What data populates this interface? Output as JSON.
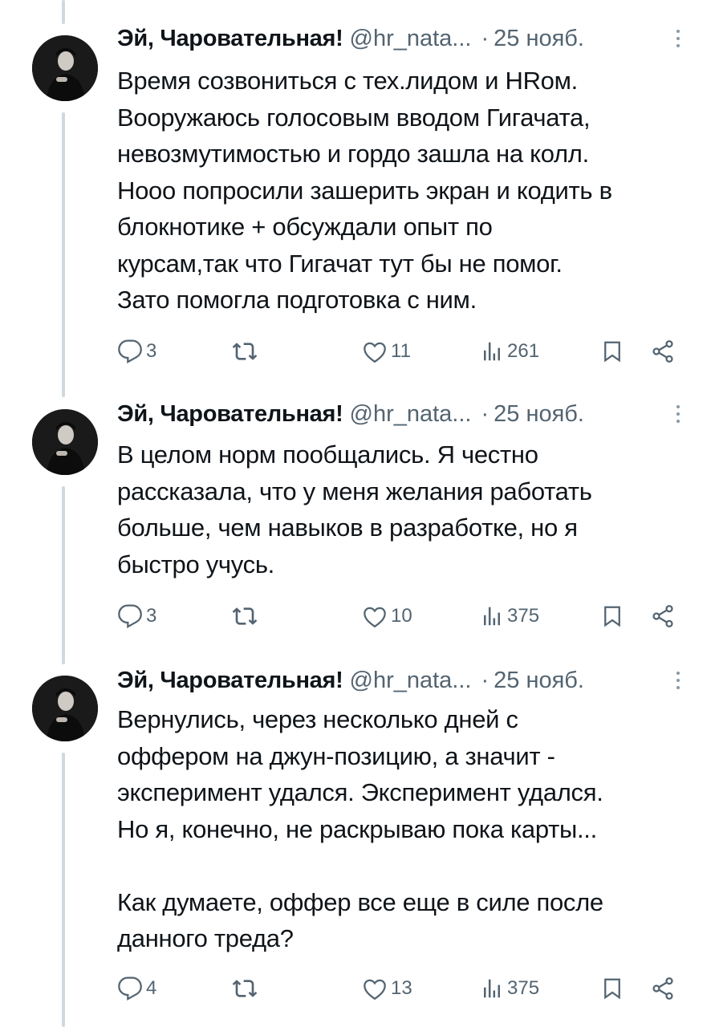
{
  "tweets": [
    {
      "author_name": "Эй, Чаровательная!",
      "handle": "@hr_nata...",
      "separator": "·",
      "date": "25 нояб.",
      "text": "Время созвониться с тех.лидом и HRом.\nВооружаюсь голосовым вводом Гигачата,\nневозмутимостью и гордо зашла на колл.\nНооо попросили зашерить экран и кодить в\nблокнотике + обсуждали опыт по\nкурсам,так что Гигачат тут бы не помог.\nЗато помогла подготовка с ним.",
      "replies": "3",
      "retweets": "",
      "likes": "11",
      "views": "261"
    },
    {
      "author_name": "Эй, Чаровательная!",
      "handle": "@hr_nata...",
      "separator": "·",
      "date": "25 нояб.",
      "text": "В целом норм пообщались.  Я честно\nрассказала, что у меня желания работать\nбольше, чем навыков в разработке, но я\nбыстро учусь.",
      "replies": "3",
      "retweets": "",
      "likes": "10",
      "views": "375"
    },
    {
      "author_name": "Эй, Чаровательная!",
      "handle": "@hr_nata...",
      "separator": "·",
      "date": "25 нояб.",
      "text": "Вернулись, через несколько дней с\nоффером на джун-позицию, а значит -\nэксперимент удался. Эксперимент удался.\nНо я, конечно, не раскрываю пока карты...\n\nКак думаете, оффер все еще в силе после\nданного треда?",
      "replies": "4",
      "retweets": "",
      "likes": "13",
      "views": "375"
    }
  ],
  "icons": {
    "reply": "reply-icon",
    "retweet": "retweet-icon",
    "like": "heart-icon",
    "views": "views-icon",
    "bookmark": "bookmark-icon",
    "share": "share-icon",
    "more": "more-icon"
  },
  "colors": {
    "text": "#0f1419",
    "secondary": "#536471",
    "thread_line": "#cfd9de",
    "background": "#ffffff"
  }
}
